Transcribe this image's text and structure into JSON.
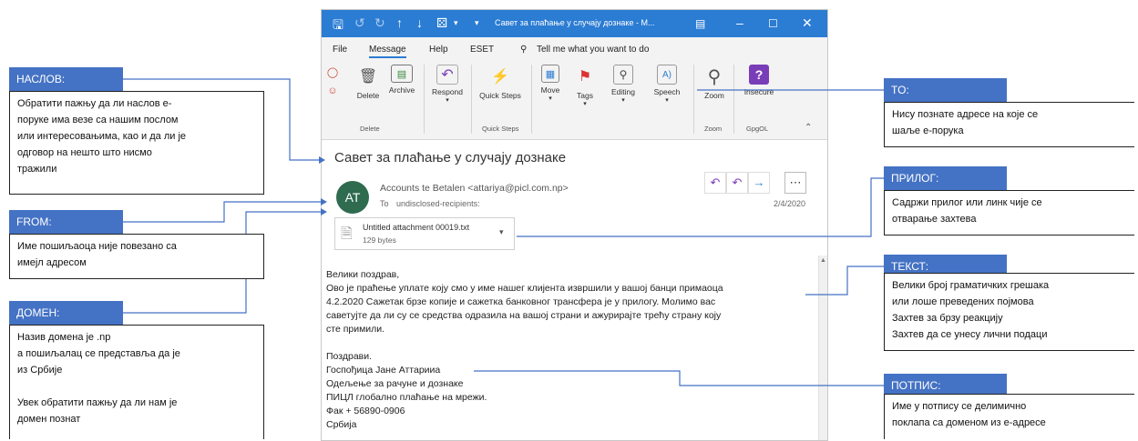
{
  "window": {
    "title": "Савет за плаћање у случају дознаке - M...",
    "menu": [
      "File",
      "Message",
      "Help",
      "ESET",
      "Tell me what you want to do"
    ],
    "ribbon": {
      "delete_label": "Delete",
      "archive_label": "Archive",
      "respond_label": "Respond",
      "quicksteps_label": "Quick Steps",
      "move_label": "Move",
      "tags_label": "Tags",
      "editing_label": "Editing",
      "speech_label": "Speech",
      "zoom_label": "Zoom",
      "insecure_label": "Insecure",
      "groups": [
        "Delete",
        "Quick Steps",
        "Zoom",
        "GpgOL"
      ]
    }
  },
  "email": {
    "subject": "Савет за плаћање у случају дознаке",
    "avatar_initials": "AT",
    "sender": "Accounts te Betalen <attariya@picl.com.np>",
    "to_label": "To",
    "to_value": "undisclosed-recipients:",
    "date": "2/4/2020",
    "attachment_name": "Untitled attachment 00019.txt",
    "attachment_size": "129 bytes",
    "body_lines": [
      "Велики поздрав,",
      "Ово је праћење уплате коју смо у име нашег клијента извршили у вашој банци примаоца",
      "4.2.2020 Сажетак брзе копије и сажетка банковног трансфера је у прилогу. Молимо вас",
      "саветујте да ли су се средства одразила на вашој страни и ажурирајте трећу страну коју",
      "сте примили.",
      "",
      "Поздрави.",
      "Госпођица Јане Аттарииа",
      "Одељење за рачуне и дознаке",
      "ПИЦЛ глобално плаћање на мрежи.",
      "Фак + 56890-0906",
      "Србија"
    ]
  },
  "annotations": {
    "naslov": {
      "title": "НАСЛОВ:",
      "text": [
        "Обратити пажњу да ли наслов е-",
        "поруке има везе са нашим послом",
        "или интересовањима, као и да ли је",
        "одговор на нешто што нисмо",
        "тражили"
      ]
    },
    "from": {
      "title": "FROM:",
      "text": [
        "Име пошиљаоца није повезано са",
        "имејл адресом"
      ]
    },
    "domen": {
      "title": "ДОМЕН:",
      "text": [
        "Назив домена је .np",
        "а пошиљалац се представља да је",
        "из Србије",
        "",
        "Увек обратити пажњу да ли нам је",
        "домен познат"
      ]
    },
    "to": {
      "title": "TO:",
      "text": [
        "Нису познате адресе на које се",
        "шаље е-порука"
      ]
    },
    "prilog": {
      "title": "ПРИЛОГ:",
      "text": [
        "Садржи прилог или линк чије се",
        "отварање захтева"
      ]
    },
    "tekst": {
      "title": "ТЕКСТ:",
      "text": [
        "Велики број граматичких грешака",
        "или  лоше преведених појмова",
        "Захтев за брзу реакцију",
        "Захтев да се унесу лични подаци"
      ]
    },
    "potpis": {
      "title": "ПОТПИС:",
      "text": [
        "Име у потпису се делимично",
        "поклапа са доменом из е-адресе"
      ]
    }
  }
}
